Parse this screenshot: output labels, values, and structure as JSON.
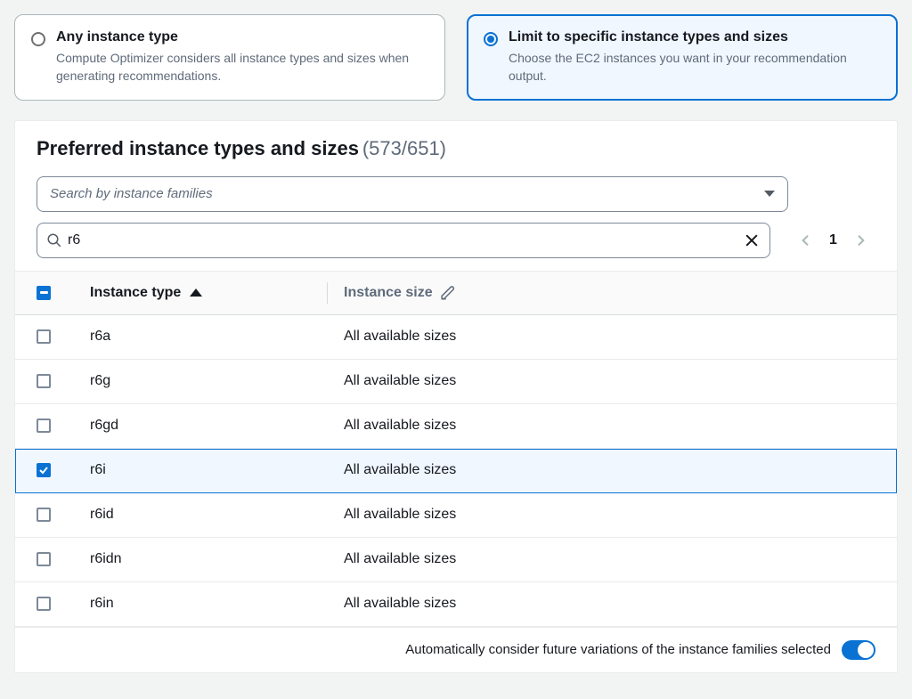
{
  "options": {
    "any": {
      "title": "Any instance type",
      "desc": "Compute Optimizer considers all instance types and sizes when generating recommendations."
    },
    "limit": {
      "title": "Limit to specific instance types and sizes",
      "desc": "Choose the EC2 instances you want in your recommendation output."
    },
    "selected": "limit"
  },
  "panel": {
    "title": "Preferred instance types and sizes",
    "count": "(573/651)"
  },
  "dropdown": {
    "placeholder": "Search by instance families"
  },
  "search": {
    "value": "r6"
  },
  "pagination": {
    "page": "1"
  },
  "columns": {
    "type": "Instance type",
    "size": "Instance size"
  },
  "rows": [
    {
      "type": "r6a",
      "size": "All available sizes",
      "checked": false
    },
    {
      "type": "r6g",
      "size": "All available sizes",
      "checked": false
    },
    {
      "type": "r6gd",
      "size": "All available sizes",
      "checked": false
    },
    {
      "type": "r6i",
      "size": "All available sizes",
      "checked": true
    },
    {
      "type": "r6id",
      "size": "All available sizes",
      "checked": false
    },
    {
      "type": "r6idn",
      "size": "All available sizes",
      "checked": false
    },
    {
      "type": "r6in",
      "size": "All available sizes",
      "checked": false
    }
  ],
  "footer": {
    "auto_label": "Automatically consider future variations of the instance families selected",
    "auto_on": true
  }
}
